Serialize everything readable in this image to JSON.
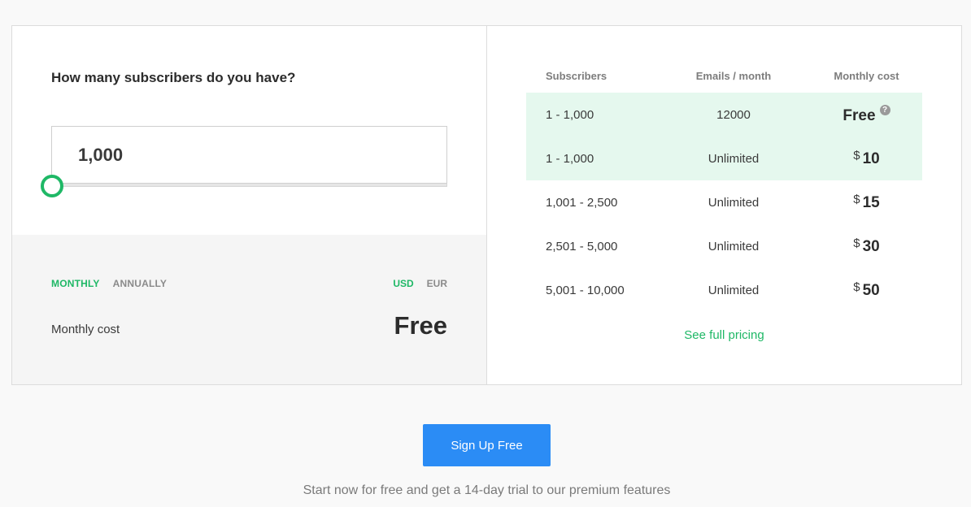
{
  "calculator": {
    "question": "How many subscribers do you have?",
    "subscriber_value": "1,000",
    "slider_fraction": 0.0
  },
  "billing": {
    "monthly_label": "MONTHLY",
    "annually_label": "ANNUALLY",
    "usd_label": "USD",
    "eur_label": "EUR",
    "cost_label": "Monthly cost",
    "cost_value": "Free"
  },
  "pricing": {
    "headers": {
      "subscribers": "Subscribers",
      "emails": "Emails / month",
      "cost": "Monthly cost"
    },
    "rows": [
      {
        "subscribers": "1  -  1,000",
        "emails": "12000",
        "currency": "",
        "amount": "Free",
        "help": "?"
      },
      {
        "subscribers": "1  -  1,000",
        "emails": "Unlimited",
        "currency": "$",
        "amount": "10"
      },
      {
        "subscribers": "1,001  -  2,500",
        "emails": "Unlimited",
        "currency": "$",
        "amount": "15"
      },
      {
        "subscribers": "2,501  -  5,000",
        "emails": "Unlimited",
        "currency": "$",
        "amount": "30"
      },
      {
        "subscribers": "5,001  -  10,000",
        "emails": "Unlimited",
        "currency": "$",
        "amount": "50"
      }
    ],
    "full_pricing_link": "See full pricing"
  },
  "cta": {
    "signup_label": "Sign Up Free",
    "tagline": "Start now for free and get a 14-day trial to our premium features"
  },
  "colors": {
    "accent_green": "#1fb866",
    "highlight_bg": "#e5f8ee",
    "button_blue": "#2b8cf5"
  }
}
